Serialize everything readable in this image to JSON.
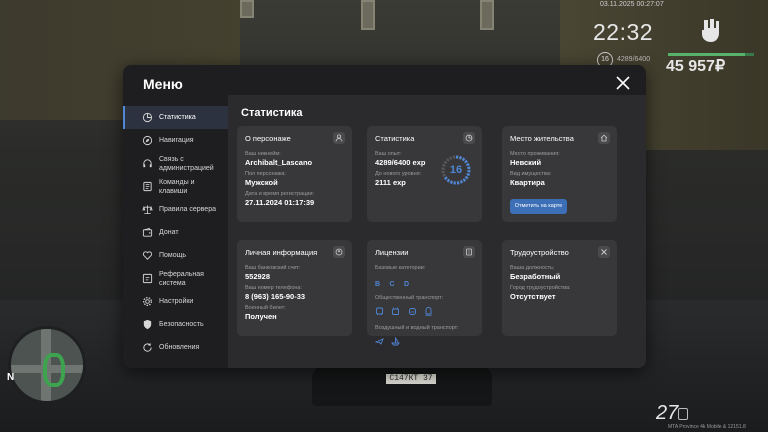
{
  "hud": {
    "date": "03.11.2025 00:27:07",
    "time": "22:32",
    "level": "16",
    "exp": "4289/6400",
    "money": "45 957₽",
    "ammo": "27",
    "build": "MTA Province 4k Mobile & 12151.8",
    "health_fraction": 0.9,
    "plate": "С147КТ 37",
    "minimap_north": "N"
  },
  "modal": {
    "title": "Меню",
    "close_icon": "close-icon"
  },
  "sidebar": {
    "items": [
      {
        "label": "Статистика",
        "icon": "stats-icon",
        "active": true
      },
      {
        "label": "Навигация",
        "icon": "navigation-icon"
      },
      {
        "label": "Связь с администрацией",
        "icon": "headset-icon"
      },
      {
        "label": "Команды и клавиши",
        "icon": "keyboard-icon"
      },
      {
        "label": "Правила сервера",
        "icon": "scales-icon"
      },
      {
        "label": "Донат",
        "icon": "wallet-icon"
      },
      {
        "label": "Помощь",
        "icon": "heart-icon"
      },
      {
        "label": "Реферальная система",
        "icon": "referral-icon"
      },
      {
        "label": "Настройки",
        "icon": "gear-icon"
      },
      {
        "label": "Безопасность",
        "icon": "shield-icon"
      },
      {
        "label": "Обновления",
        "icon": "refresh-icon"
      }
    ]
  },
  "content": {
    "title": "Статистика",
    "persona": {
      "title": "О персонаже",
      "nick_label": "Ваш никнейм:",
      "nick": "Archibalt_Lascano",
      "gender_label": "Пол персонажа:",
      "gender": "Мужской",
      "reg_label": "Дата и время регистрации:",
      "reg": "27.11.2024 01:17:39"
    },
    "stats": {
      "title": "Статистика",
      "exp_label": "Ваш опыт:",
      "exp": "4289/6400 exp",
      "next_label": "До нового уровня:",
      "next": "2111 exp",
      "level": "16",
      "progress": 0.67
    },
    "residence": {
      "title": "Место жительства",
      "place_label": "Место проживания:",
      "place": "Невский",
      "property_label": "Вид имущества:",
      "property": "Квартира",
      "map_button": "Отметить на карте"
    },
    "personal": {
      "title": "Личная информация",
      "bank_label": "Ваш банковский счет:",
      "bank": "552928",
      "phone_label": "Ваш номер телефона:",
      "phone": "8 (963) 165-90-33",
      "military_label": "Военный билет:",
      "military": "Получен"
    },
    "licenses": {
      "title": "Лицензии",
      "base_label": "Базовые категории:",
      "categories": [
        "B",
        "C",
        "D"
      ],
      "public_label": "Общественный транспорт:",
      "air_label": "Воздушный и водный транспорт:"
    },
    "employment": {
      "title": "Трудоустройство",
      "position_label": "Ваша должность:",
      "position": "Безработный",
      "city_label": "Город трудоустройства:",
      "city": "Отсутствует"
    }
  },
  "colors": {
    "accent": "#4f86d6",
    "card": "#38383a",
    "panel": "#2b2b2d",
    "modal": "#1e1e20"
  }
}
